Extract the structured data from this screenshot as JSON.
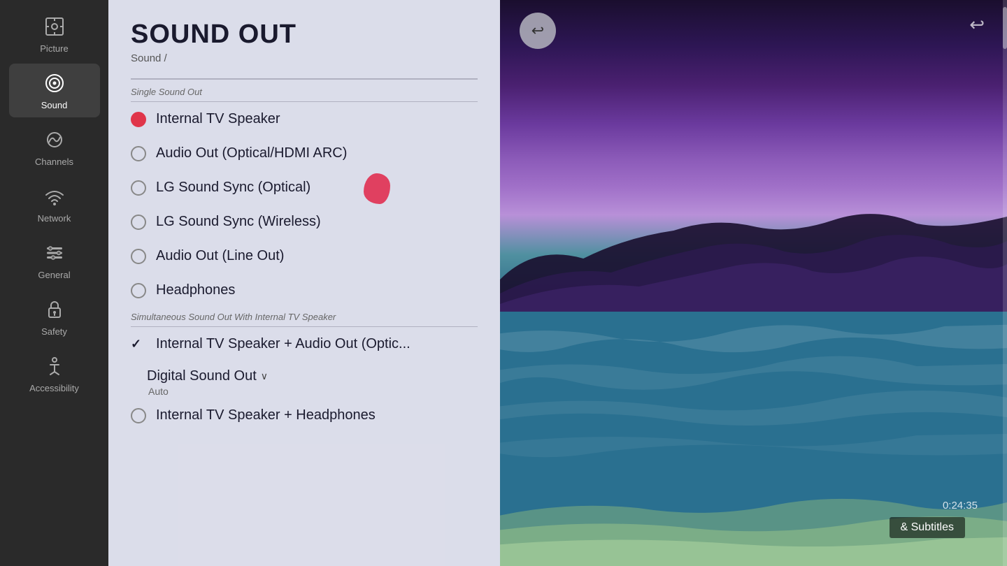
{
  "sidebar": {
    "items": [
      {
        "id": "picture",
        "label": "Picture",
        "icon": "⚙"
      },
      {
        "id": "sound",
        "label": "Sound",
        "icon": "🔊",
        "active": true
      },
      {
        "id": "channels",
        "label": "Channels",
        "icon": "📡"
      },
      {
        "id": "network",
        "label": "Network",
        "icon": "🌐"
      },
      {
        "id": "general",
        "label": "General",
        "icon": "🔧"
      },
      {
        "id": "safety",
        "label": "Safety",
        "icon": "🔒"
      },
      {
        "id": "accessibility",
        "label": "Accessibility",
        "icon": "♿"
      }
    ]
  },
  "menu": {
    "title": "SOUND OUT",
    "breadcrumb": "Sound /",
    "sections": [
      {
        "label": "Single Sound Out",
        "options": [
          {
            "id": "internal-tv",
            "text": "Internal TV Speaker",
            "selected": true,
            "radio": true
          },
          {
            "id": "audio-optical",
            "text": "Audio Out (Optical/HDMI ARC)",
            "selected": false,
            "radio": true
          },
          {
            "id": "lg-optical",
            "text": "LG Sound Sync (Optical)",
            "selected": false,
            "radio": true
          },
          {
            "id": "lg-wireless",
            "text": "LG Sound Sync (Wireless)",
            "selected": false,
            "radio": true
          },
          {
            "id": "audio-line",
            "text": "Audio Out (Line Out)",
            "selected": false,
            "radio": true
          },
          {
            "id": "headphones",
            "text": "Headphones",
            "selected": false,
            "radio": true
          }
        ]
      },
      {
        "label": "Simultaneous Sound Out With Internal TV Speaker",
        "options": [
          {
            "id": "internal-audio-optical",
            "text": "Internal TV Speaker + Audio Out (Optic...",
            "selected": false,
            "radio": false,
            "checkmark": true
          },
          {
            "id": "digital-sound-out",
            "text": "Digital Sound Out",
            "sub": "Auto",
            "special": true,
            "chevron": true
          },
          {
            "id": "internal-headphones",
            "text": "Internal TV Speaker + Headphones",
            "selected": false,
            "radio": true
          }
        ]
      }
    ]
  },
  "video": {
    "timestamp": "0:24:35",
    "subtitles_label": "& Subtitles"
  },
  "back_button_symbol": "↩",
  "top_right_symbol": "↩"
}
